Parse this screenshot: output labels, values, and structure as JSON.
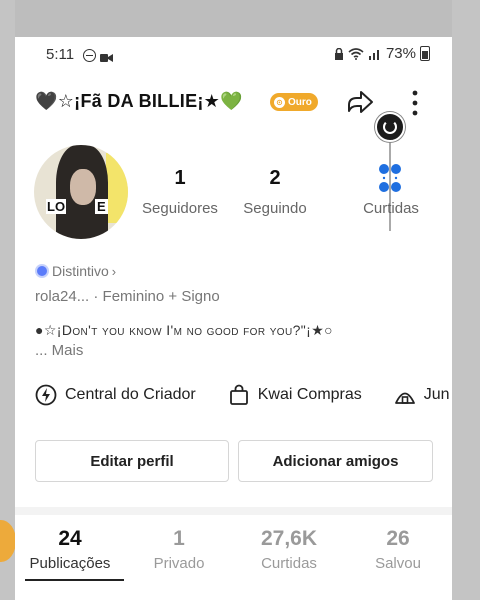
{
  "status_bar": {
    "time": "5:11",
    "battery": "73%"
  },
  "profile": {
    "title": "🖤☆¡Fã DA BILLIE¡★",
    "title_heart": "💚",
    "badge": "Ouro",
    "avatar_text_left": "LO",
    "avatar_text_right": "E",
    "distintivo": "Distintivo",
    "meta": "rola24... · Feminino    + Signo",
    "bio": "●☆¡Don't you know I'm no good for you?\"¡★○",
    "mais": "... Mais"
  },
  "stats": [
    {
      "num": "1",
      "label": "Seguidores"
    },
    {
      "num": "2",
      "label": "Seguindo"
    },
    {
      "label": "Curtidas"
    }
  ],
  "shortcuts": [
    {
      "label": "Central do Criador",
      "icon": "bolt-icon"
    },
    {
      "label": "Kwai Compras",
      "icon": "shopping-bag-icon"
    },
    {
      "label": "Jun",
      "icon": "tent-icon"
    }
  ],
  "buttons": {
    "edit": "Editar perfil",
    "add": "Adicionar amigos"
  },
  "tabs": [
    {
      "num": "24",
      "label": "Publicações"
    },
    {
      "num": "1",
      "label": "Privado"
    },
    {
      "num": "27,6K",
      "label": "Curtidas"
    },
    {
      "num": "26",
      "label": "Salvou"
    }
  ],
  "colors": {
    "accent_gold": "#f0a92b",
    "likes_blue": "#1f6fe0",
    "badge_blue": "#5b7cfa"
  }
}
